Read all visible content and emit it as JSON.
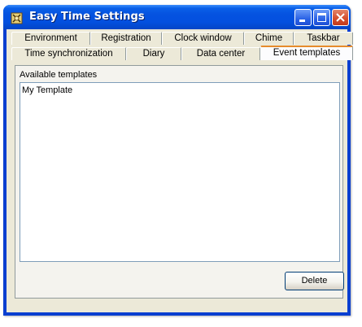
{
  "window": {
    "title": "Easy Time Settings",
    "controls": {
      "minimize": "minimize-icon",
      "maximize": "maximize-icon",
      "close": "close-icon"
    }
  },
  "tabs": {
    "row1": [
      {
        "label": "Environment",
        "selected": false
      },
      {
        "label": "Registration",
        "selected": false
      },
      {
        "label": "Clock window",
        "selected": false
      },
      {
        "label": "Chime",
        "selected": false
      },
      {
        "label": "Taskbar",
        "selected": false
      }
    ],
    "row2": [
      {
        "label": "Time synchronization",
        "selected": false
      },
      {
        "label": "Diary",
        "selected": false
      },
      {
        "label": "Data center",
        "selected": false
      },
      {
        "label": "Event templates",
        "selected": true
      }
    ]
  },
  "panel": {
    "available_label": "Available templates",
    "templates": [
      "My Template"
    ],
    "delete_label": "Delete"
  },
  "colors": {
    "titlebar": "#0552e0",
    "dialog_bg": "#ece9d8",
    "selected_tab_accent": "#e68b2c",
    "close_button": "#d6502f"
  }
}
